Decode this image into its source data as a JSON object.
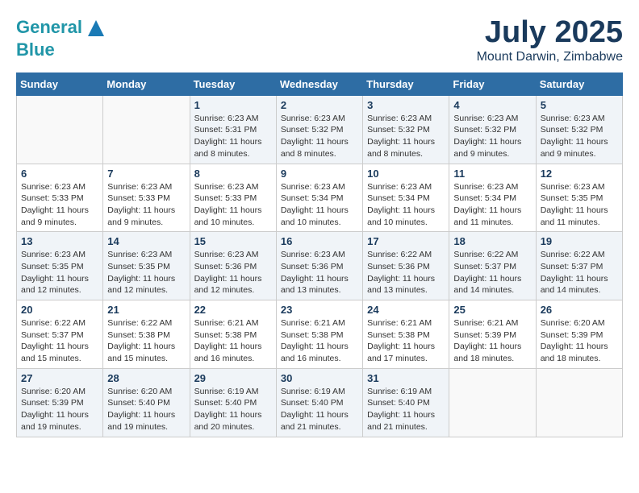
{
  "header": {
    "logo_line1": "General",
    "logo_line2": "Blue",
    "month_title": "July 2025",
    "location": "Mount Darwin, Zimbabwe"
  },
  "days_of_week": [
    "Sunday",
    "Monday",
    "Tuesday",
    "Wednesday",
    "Thursday",
    "Friday",
    "Saturday"
  ],
  "weeks": [
    [
      {
        "day": "",
        "info": ""
      },
      {
        "day": "",
        "info": ""
      },
      {
        "day": "1",
        "info": "Sunrise: 6:23 AM\nSunset: 5:31 PM\nDaylight: 11 hours and 8 minutes."
      },
      {
        "day": "2",
        "info": "Sunrise: 6:23 AM\nSunset: 5:32 PM\nDaylight: 11 hours and 8 minutes."
      },
      {
        "day": "3",
        "info": "Sunrise: 6:23 AM\nSunset: 5:32 PM\nDaylight: 11 hours and 8 minutes."
      },
      {
        "day": "4",
        "info": "Sunrise: 6:23 AM\nSunset: 5:32 PM\nDaylight: 11 hours and 9 minutes."
      },
      {
        "day": "5",
        "info": "Sunrise: 6:23 AM\nSunset: 5:32 PM\nDaylight: 11 hours and 9 minutes."
      }
    ],
    [
      {
        "day": "6",
        "info": "Sunrise: 6:23 AM\nSunset: 5:33 PM\nDaylight: 11 hours and 9 minutes."
      },
      {
        "day": "7",
        "info": "Sunrise: 6:23 AM\nSunset: 5:33 PM\nDaylight: 11 hours and 9 minutes."
      },
      {
        "day": "8",
        "info": "Sunrise: 6:23 AM\nSunset: 5:33 PM\nDaylight: 11 hours and 10 minutes."
      },
      {
        "day": "9",
        "info": "Sunrise: 6:23 AM\nSunset: 5:34 PM\nDaylight: 11 hours and 10 minutes."
      },
      {
        "day": "10",
        "info": "Sunrise: 6:23 AM\nSunset: 5:34 PM\nDaylight: 11 hours and 10 minutes."
      },
      {
        "day": "11",
        "info": "Sunrise: 6:23 AM\nSunset: 5:34 PM\nDaylight: 11 hours and 11 minutes."
      },
      {
        "day": "12",
        "info": "Sunrise: 6:23 AM\nSunset: 5:35 PM\nDaylight: 11 hours and 11 minutes."
      }
    ],
    [
      {
        "day": "13",
        "info": "Sunrise: 6:23 AM\nSunset: 5:35 PM\nDaylight: 11 hours and 12 minutes."
      },
      {
        "day": "14",
        "info": "Sunrise: 6:23 AM\nSunset: 5:35 PM\nDaylight: 11 hours and 12 minutes."
      },
      {
        "day": "15",
        "info": "Sunrise: 6:23 AM\nSunset: 5:36 PM\nDaylight: 11 hours and 12 minutes."
      },
      {
        "day": "16",
        "info": "Sunrise: 6:23 AM\nSunset: 5:36 PM\nDaylight: 11 hours and 13 minutes."
      },
      {
        "day": "17",
        "info": "Sunrise: 6:22 AM\nSunset: 5:36 PM\nDaylight: 11 hours and 13 minutes."
      },
      {
        "day": "18",
        "info": "Sunrise: 6:22 AM\nSunset: 5:37 PM\nDaylight: 11 hours and 14 minutes."
      },
      {
        "day": "19",
        "info": "Sunrise: 6:22 AM\nSunset: 5:37 PM\nDaylight: 11 hours and 14 minutes."
      }
    ],
    [
      {
        "day": "20",
        "info": "Sunrise: 6:22 AM\nSunset: 5:37 PM\nDaylight: 11 hours and 15 minutes."
      },
      {
        "day": "21",
        "info": "Sunrise: 6:22 AM\nSunset: 5:38 PM\nDaylight: 11 hours and 15 minutes."
      },
      {
        "day": "22",
        "info": "Sunrise: 6:21 AM\nSunset: 5:38 PM\nDaylight: 11 hours and 16 minutes."
      },
      {
        "day": "23",
        "info": "Sunrise: 6:21 AM\nSunset: 5:38 PM\nDaylight: 11 hours and 16 minutes."
      },
      {
        "day": "24",
        "info": "Sunrise: 6:21 AM\nSunset: 5:38 PM\nDaylight: 11 hours and 17 minutes."
      },
      {
        "day": "25",
        "info": "Sunrise: 6:21 AM\nSunset: 5:39 PM\nDaylight: 11 hours and 18 minutes."
      },
      {
        "day": "26",
        "info": "Sunrise: 6:20 AM\nSunset: 5:39 PM\nDaylight: 11 hours and 18 minutes."
      }
    ],
    [
      {
        "day": "27",
        "info": "Sunrise: 6:20 AM\nSunset: 5:39 PM\nDaylight: 11 hours and 19 minutes."
      },
      {
        "day": "28",
        "info": "Sunrise: 6:20 AM\nSunset: 5:40 PM\nDaylight: 11 hours and 19 minutes."
      },
      {
        "day": "29",
        "info": "Sunrise: 6:19 AM\nSunset: 5:40 PM\nDaylight: 11 hours and 20 minutes."
      },
      {
        "day": "30",
        "info": "Sunrise: 6:19 AM\nSunset: 5:40 PM\nDaylight: 11 hours and 21 minutes."
      },
      {
        "day": "31",
        "info": "Sunrise: 6:19 AM\nSunset: 5:40 PM\nDaylight: 11 hours and 21 minutes."
      },
      {
        "day": "",
        "info": ""
      },
      {
        "day": "",
        "info": ""
      }
    ]
  ]
}
